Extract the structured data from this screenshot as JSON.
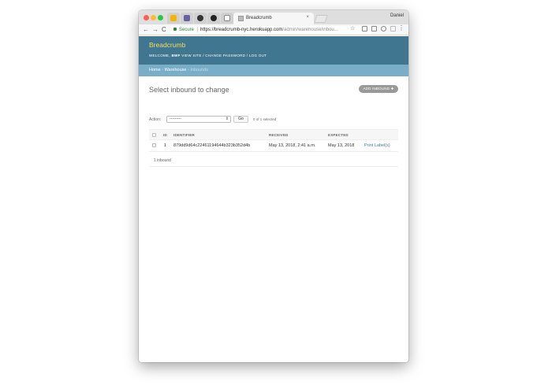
{
  "browser": {
    "tab_title": "Breadcrumb",
    "tab_close": "×",
    "profile_name": "Daniel",
    "secure_label": "Secure",
    "url_host": "https://breadcrumb-nyc.herokuapp.com",
    "url_path": "/admin/warehouse/inbou...",
    "nav_back": "←",
    "nav_forward": "→",
    "nav_reload": "C",
    "bookmark_star": "☆",
    "menu_dots": "⋮"
  },
  "header": {
    "site_name": "Breadcrumb",
    "welcome": "WELCOME,",
    "username": "BWF",
    "view_site": "VIEW SITE",
    "sep1": " / ",
    "change_password": "CHANGE PASSWORD",
    "sep2": " / ",
    "log_out": "LOG OUT"
  },
  "breadcrumbs": {
    "home": "Home",
    "sep": " › ",
    "warehouse": "Warehouse",
    "current": "Inbounds"
  },
  "page": {
    "title": "Select inbound to change",
    "add_button": "ADD INBOUND  ✚"
  },
  "actions": {
    "label": "Action:",
    "selected_value": "---------",
    "go_label": "Go",
    "selected_count": "0 of 1 selected"
  },
  "table": {
    "columns": [
      "ID",
      "IDENTIFIER",
      "RECEIVED",
      "EXPECTED"
    ],
    "rows": [
      {
        "id": "1",
        "identifier": "879dd9d64c22461194644b323b352d4b",
        "received": "May 13, 2018, 2:41 a.m.",
        "expected": "May 13, 2018",
        "action": "Print Label(s)"
      }
    ]
  },
  "paginator": {
    "text": "1 inbound"
  },
  "colors": {
    "header_bg": "#417690",
    "breadcrumbs_bg": "#79aec8",
    "branding": "#f5dd5d",
    "link": "#447e9b"
  }
}
